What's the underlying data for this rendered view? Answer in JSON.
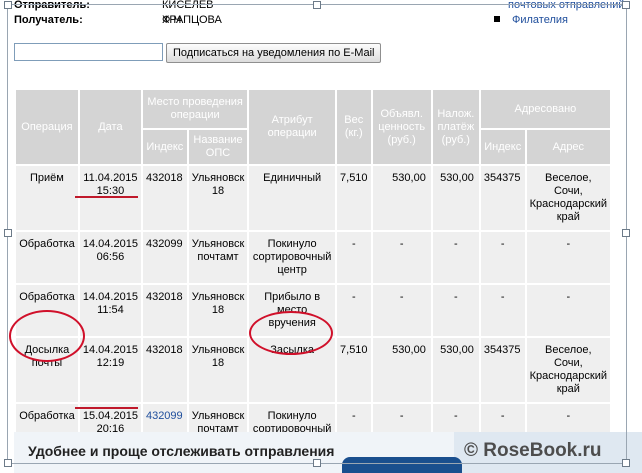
{
  "header": {
    "sender_label": "Отправитель:",
    "sender_value": "КИСЕЛЕВ Ф Н",
    "recipient_label": "Получатель:",
    "recipient_value": "ХРАПЦОВА"
  },
  "right_links": {
    "link1": "почтовых отправлений",
    "link2": "Филателия"
  },
  "subscribe": {
    "email_value": "",
    "button_label": "Подписаться на уведомления по E-Mail"
  },
  "table": {
    "headers": {
      "operation": "Операция",
      "date": "Дата",
      "place": "Место проведения операции",
      "attribute": "Атрибут операции",
      "weight": "Вес (кг.)",
      "declared_value": "Объявл. ценность (руб.)",
      "cod": "Налож. платёж (руб.)",
      "addressed": "Адресовано",
      "index": "Индекс",
      "ops_name": "Название ОПС",
      "addr_index": "Индекс",
      "address": "Адрес"
    },
    "rows": [
      {
        "operation": "Приём",
        "date": "11.04.2015",
        "time": "15:30",
        "index": "432018",
        "ops": "Ульяновск 18",
        "attribute": "Единичный",
        "weight": "7,510",
        "declared": "530,00",
        "cod": "530,00",
        "addr_index": "354375",
        "address": "Веселое, Сочи, Краснодарский край"
      },
      {
        "operation": "Обработка",
        "date": "14.04.2015",
        "time": "06:56",
        "index": "432099",
        "ops": "Ульяновск почтамт",
        "attribute": "Покинуло сортировочный центр",
        "weight": "-",
        "declared": "-",
        "cod": "-",
        "addr_index": "-",
        "address": "-"
      },
      {
        "operation": "Обработка",
        "date": "14.04.2015",
        "time": "11:54",
        "index": "432018",
        "ops": "Ульяновск 18",
        "attribute": "Прибыло в место вручения",
        "weight": "-",
        "declared": "-",
        "cod": "-",
        "addr_index": "-",
        "address": "-"
      },
      {
        "operation": "Досылка почты",
        "date": "14.04.2015",
        "time": "12:19",
        "index": "432018",
        "ops": "Ульяновск 18",
        "attribute": "Засылка",
        "weight": "7,510",
        "declared": "530,00",
        "cod": "530,00",
        "addr_index": "354375",
        "address": "Веселое, Сочи, Краснодарский край"
      },
      {
        "operation": "Обработка",
        "date": "15.04.2015",
        "time": "20:16",
        "index": "432099",
        "ops": "Ульяновск почтамт",
        "attribute": "Покинуло сортировочный центр",
        "weight": "-",
        "declared": "-",
        "cod": "-",
        "addr_index": "-",
        "address": "-"
      }
    ]
  },
  "promo": {
    "text": "Удобнее и проще отслеживать отправления"
  },
  "watermark": "© RoseBook.ru",
  "colors": {
    "header_bg": "#d4d4d4",
    "cell_bg": "#efefef",
    "link": "#1f4e9c",
    "annotation_red": "#d0102a"
  }
}
